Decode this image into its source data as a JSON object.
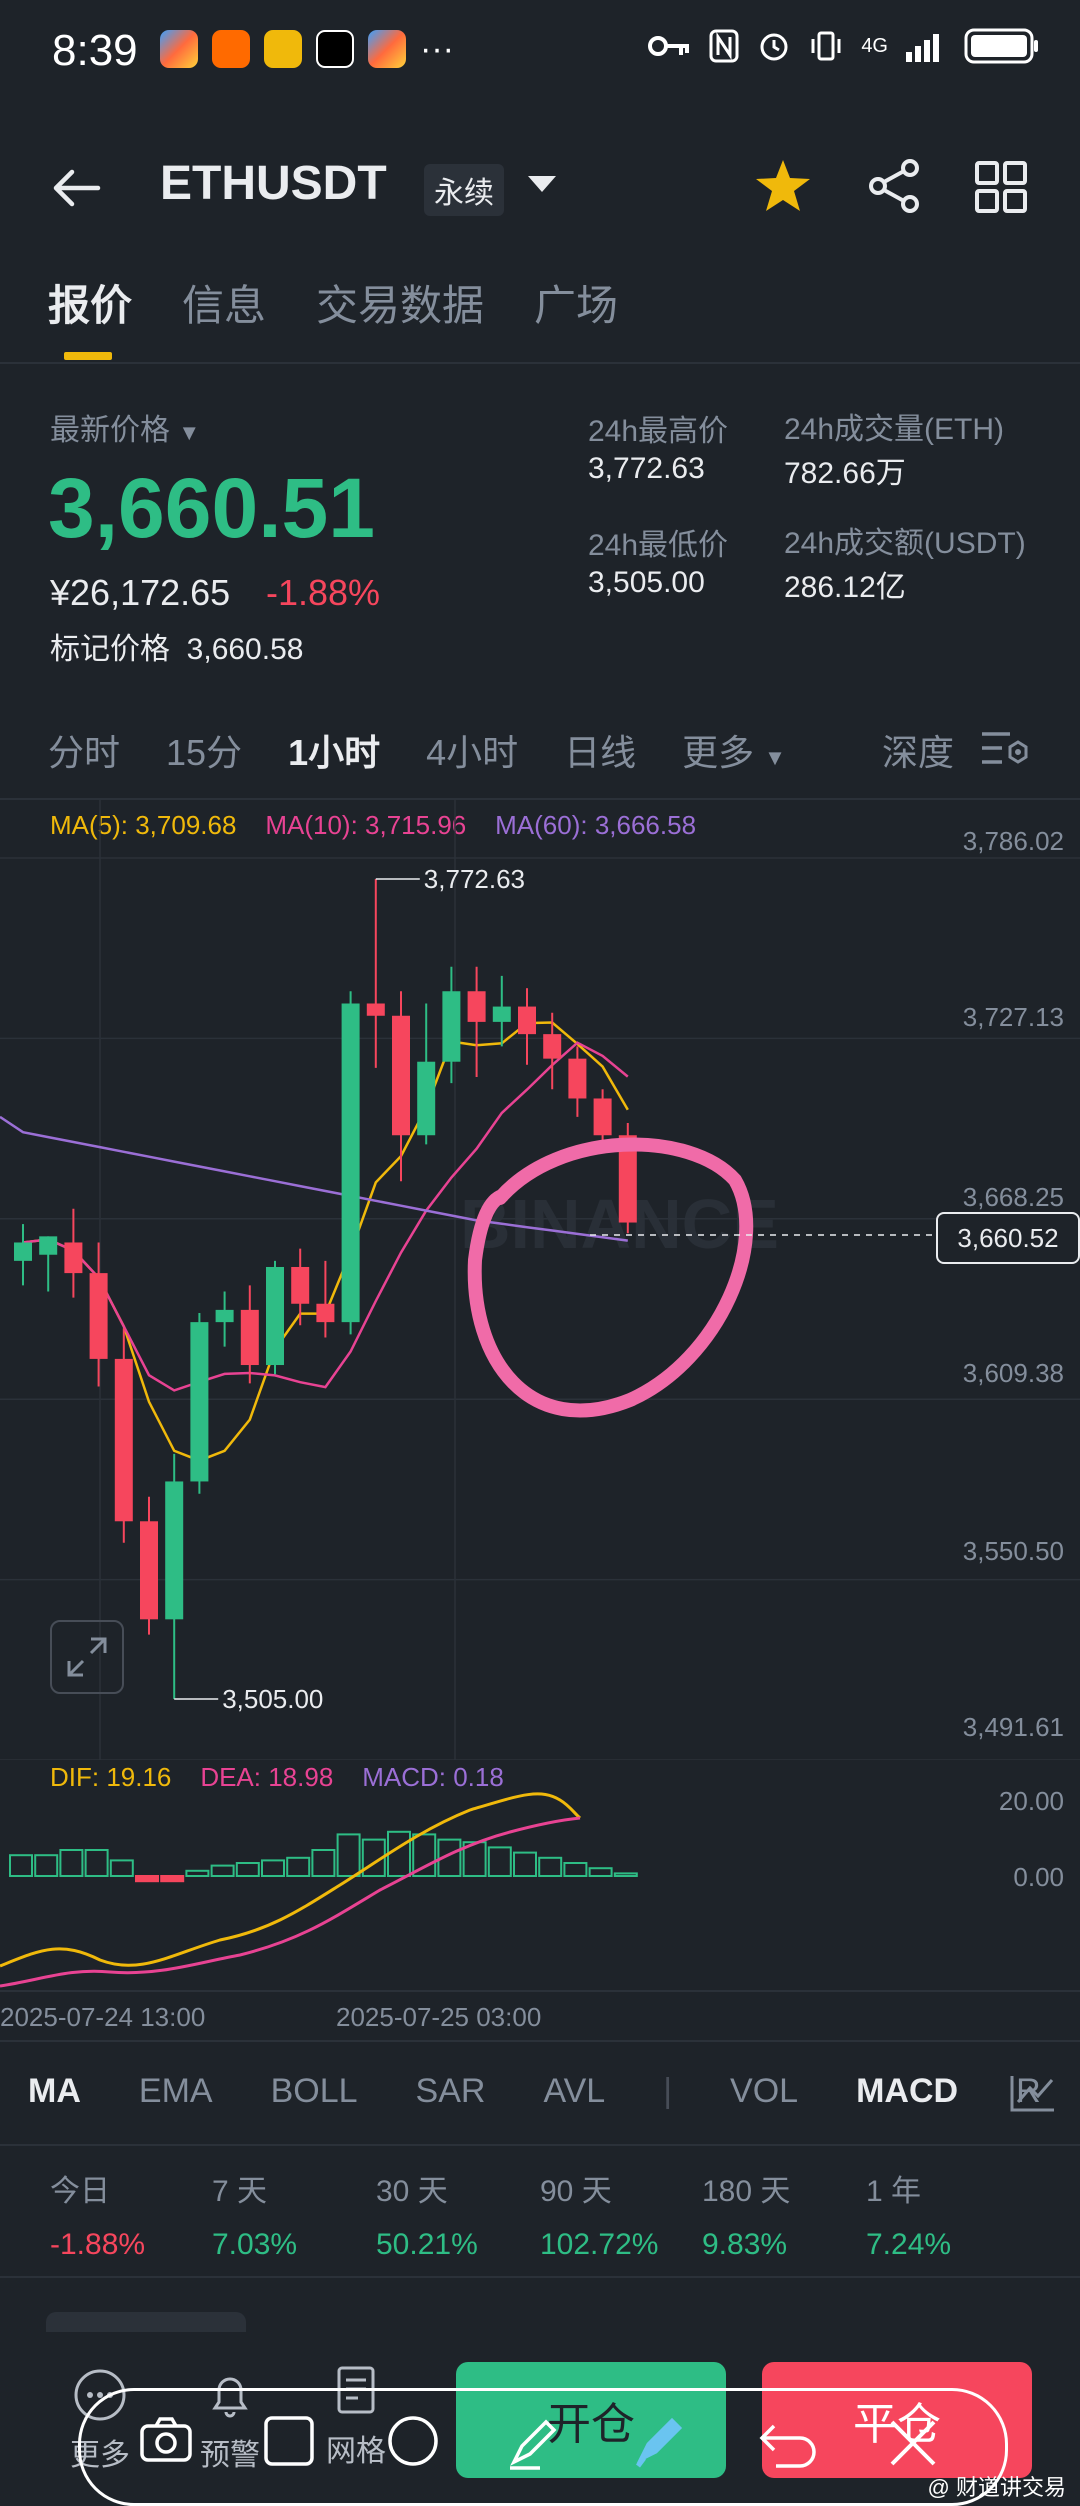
{
  "status_bar": {
    "time": "8:39",
    "icons": [
      "app-1-icon",
      "taobao-icon",
      "app-3-icon",
      "app-4-icon",
      "app-5-icon"
    ],
    "more": "···",
    "network": "4G"
  },
  "header": {
    "symbol": "ETHUSDT",
    "contract": "永续"
  },
  "tabs": [
    "报价",
    "信息",
    "交易数据",
    "广场"
  ],
  "quote": {
    "last_label": "最新价格",
    "last_price": "3,660.51",
    "cny": "¥26,172.65",
    "change": "-1.88%",
    "mark_label": "标记价格",
    "mark_price": "3,660.58",
    "high_label": "24h最高价",
    "high": "3,772.63",
    "low_label": "24h最低价",
    "low": "3,505.00",
    "vol_eth_label": "24h成交量(ETH)",
    "vol_eth": "782.66万",
    "vol_usdt_label": "24h成交额(USDT)",
    "vol_usdt": "286.12亿"
  },
  "timeframes": [
    "分时",
    "15分",
    "1小时",
    "4小时",
    "日线",
    "更多"
  ],
  "depth_label": "深度",
  "ma_legend": {
    "ma5": "MA(5): 3,709.68",
    "ma10": "MA(10): 3,715.96",
    "ma60": "MA(60): 3,666.58"
  },
  "price_axis": [
    "3,786.02",
    "3,727.13",
    "3,668.25",
    "3,609.38",
    "3,550.50",
    "3,491.61"
  ],
  "current_price_tag": "3,660.52",
  "high_marker": "3,772.63",
  "low_marker": "3,505.00",
  "watermark_text": "BINANCE",
  "macd_legend": {
    "dif": "DIF: 19.16",
    "dea": "DEA: 18.98",
    "macd": "MACD: 0.18"
  },
  "macd_axis": [
    "20.00",
    "0.00"
  ],
  "x_axis": [
    "2025-07-24 13:00",
    "2025-07-25 03:00"
  ],
  "indicators": [
    "MA",
    "EMA",
    "BOLL",
    "SAR",
    "AVL",
    "VOL",
    "MACD",
    "R"
  ],
  "performance": [
    {
      "label": "今日",
      "value": "-1.88%"
    },
    {
      "label": "7 天",
      "value": "7.03%"
    },
    {
      "label": "30 天",
      "value": "50.21%"
    },
    {
      "label": "90 天",
      "value": "102.72%"
    },
    {
      "label": "180 天",
      "value": "9.83%"
    },
    {
      "label": "1 年",
      "value": "7.24%"
    }
  ],
  "bottom_bar": {
    "more": "更多",
    "alert": "预警",
    "grid": "网格",
    "open": "开仓",
    "close": "平仓"
  },
  "footer_watermark": "@ 财道讲交易",
  "colors": {
    "up": "#2EBD85",
    "down": "#F6465D",
    "accent": "#F0B90B",
    "ma5": "#F0B90B",
    "ma10": "#E84393",
    "ma60": "#9B6FD6",
    "annotation": "#F06BA8"
  },
  "chart_data": {
    "type": "candlestick",
    "ylim": [
      3491.61,
      3786.02
    ],
    "candles": [
      {
        "o": 3648,
        "h": 3660,
        "c": 3654,
        "l": 3640
      },
      {
        "o": 3650,
        "h": 3656,
        "c": 3656,
        "l": 3638
      },
      {
        "o": 3654,
        "h": 3665,
        "c": 3644,
        "l": 3636
      },
      {
        "o": 3644,
        "h": 3654,
        "c": 3616,
        "l": 3607
      },
      {
        "o": 3616,
        "h": 3626,
        "c": 3563,
        "l": 3556
      },
      {
        "o": 3563,
        "h": 3571,
        "c": 3531,
        "l": 3526
      },
      {
        "o": 3531,
        "h": 3585,
        "c": 3576,
        "l": 3505
      },
      {
        "o": 3576,
        "h": 3631,
        "c": 3628,
        "l": 3572
      },
      {
        "o": 3628,
        "h": 3638,
        "c": 3632,
        "l": 3620
      },
      {
        "o": 3632,
        "h": 3640,
        "c": 3614,
        "l": 3608
      },
      {
        "o": 3614,
        "h": 3648,
        "c": 3646,
        "l": 3611
      },
      {
        "o": 3646,
        "h": 3652,
        "c": 3634,
        "l": 3627
      },
      {
        "o": 3634,
        "h": 3648,
        "c": 3628,
        "l": 3623
      },
      {
        "o": 3628,
        "h": 3736,
        "c": 3732,
        "l": 3624
      },
      {
        "o": 3732,
        "h": 3772.63,
        "c": 3728,
        "l": 3711
      },
      {
        "o": 3728,
        "h": 3736,
        "c": 3689,
        "l": 3674
      },
      {
        "o": 3689,
        "h": 3732,
        "c": 3713,
        "l": 3686
      },
      {
        "o": 3713,
        "h": 3744,
        "c": 3736,
        "l": 3706
      },
      {
        "o": 3736,
        "h": 3744,
        "c": 3726,
        "l": 3708
      },
      {
        "o": 3726,
        "h": 3741,
        "c": 3731,
        "l": 3718
      },
      {
        "o": 3731,
        "h": 3737,
        "c": 3722,
        "l": 3712
      },
      {
        "o": 3722,
        "h": 3729,
        "c": 3714,
        "l": 3704
      },
      {
        "o": 3714,
        "h": 3718,
        "c": 3701,
        "l": 3695
      },
      {
        "o": 3701,
        "h": 3704,
        "c": 3689,
        "l": 3684
      },
      {
        "o": 3689,
        "h": 3693,
        "c": 3660.51,
        "l": 3657
      }
    ]
  }
}
